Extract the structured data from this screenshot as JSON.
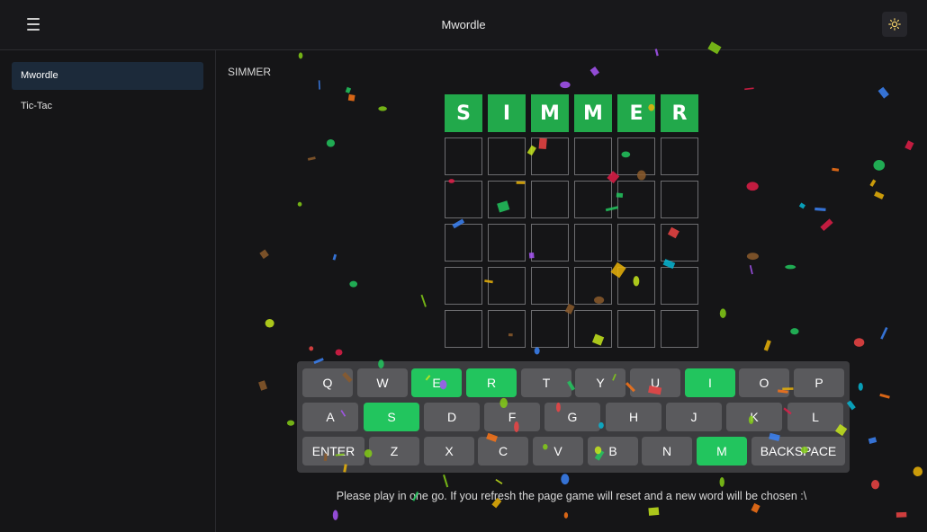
{
  "header": {
    "title": "Mwordle",
    "menu_icon": "hamburger-menu-icon",
    "theme_icon": "sun-icon"
  },
  "sidebar": {
    "items": [
      {
        "label": "Mwordle",
        "active": true
      },
      {
        "label": "Tic-Tac",
        "active": false
      }
    ]
  },
  "game": {
    "answer_label": "SIMMER",
    "guesses": [
      [
        "S",
        "I",
        "M",
        "M",
        "E",
        "R"
      ],
      [
        "",
        "",
        "",
        "",
        "",
        ""
      ],
      [
        "",
        "",
        "",
        "",
        "",
        ""
      ],
      [
        "",
        "",
        "",
        "",
        "",
        ""
      ],
      [
        "",
        "",
        "",
        "",
        "",
        ""
      ],
      [
        "",
        "",
        "",
        "",
        "",
        ""
      ]
    ],
    "row_states": [
      "correct",
      "empty",
      "empty",
      "empty",
      "empty",
      "empty"
    ],
    "colors": {
      "correct": "#22a94b",
      "key_hit": "#22c55e",
      "key_default": "#5a5a5d"
    }
  },
  "keyboard": {
    "rows": [
      [
        {
          "label": "Q",
          "hit": false
        },
        {
          "label": "W",
          "hit": false
        },
        {
          "label": "E",
          "hit": true
        },
        {
          "label": "R",
          "hit": true
        },
        {
          "label": "T",
          "hit": false
        },
        {
          "label": "Y",
          "hit": false
        },
        {
          "label": "U",
          "hit": false
        },
        {
          "label": "I",
          "hit": true
        },
        {
          "label": "O",
          "hit": false
        },
        {
          "label": "P",
          "hit": false
        }
      ],
      [
        {
          "label": "A",
          "hit": false
        },
        {
          "label": "S",
          "hit": true
        },
        {
          "label": "D",
          "hit": false
        },
        {
          "label": "F",
          "hit": false
        },
        {
          "label": "G",
          "hit": false
        },
        {
          "label": "H",
          "hit": false
        },
        {
          "label": "J",
          "hit": false
        },
        {
          "label": "K",
          "hit": false
        },
        {
          "label": "L",
          "hit": false
        }
      ],
      [
        {
          "label": "ENTER",
          "hit": false
        },
        {
          "label": "Z",
          "hit": false
        },
        {
          "label": "X",
          "hit": false
        },
        {
          "label": "C",
          "hit": false
        },
        {
          "label": "V",
          "hit": false
        },
        {
          "label": "B",
          "hit": false
        },
        {
          "label": "N",
          "hit": false
        },
        {
          "label": "M",
          "hit": true
        },
        {
          "label": "BACKSPACE",
          "hit": false
        }
      ]
    ]
  },
  "footer": {
    "note": "Please play in one go. If you refresh the page game will reset and a new word will be chosen :\\"
  },
  "confetti_colors": [
    "#22c55e",
    "#ef4444",
    "#eab308",
    "#3b82f6",
    "#06b6d4",
    "#f97316",
    "#a855f7",
    "#e11d48",
    "#8b5a2b",
    "#84cc16",
    "#c5e61c"
  ]
}
